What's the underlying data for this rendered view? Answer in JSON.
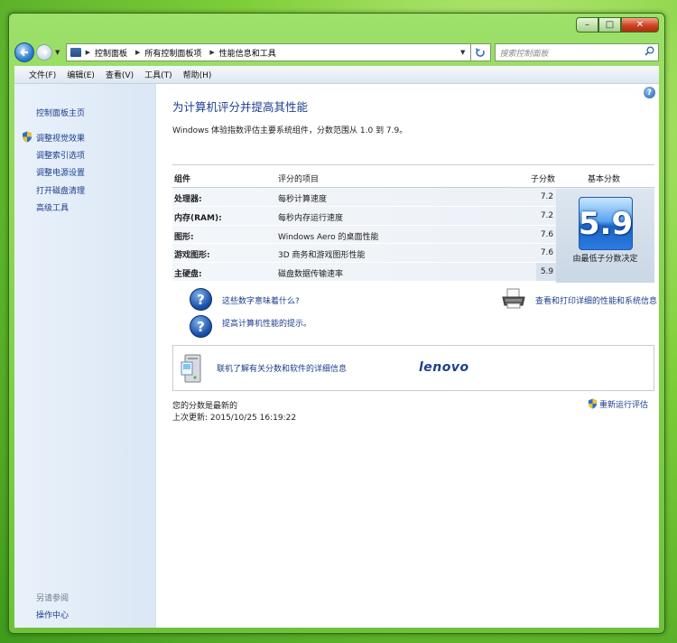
{
  "window": {
    "caption_buttons": {
      "minimize": "–",
      "maximize": "□",
      "close": "✕"
    }
  },
  "navigation": {
    "back_icon": "back-arrow-icon",
    "forward_icon": "forward-arrow-icon",
    "breadcrumb": [
      "控制面板",
      "所有控制面板项",
      "性能信息和工具"
    ],
    "search_placeholder": "搜索控制面板"
  },
  "menu": [
    "文件(F)",
    "编辑(E)",
    "查看(V)",
    "工具(T)",
    "帮助(H)"
  ],
  "sidebar": {
    "home": "控制面板主页",
    "tasks": [
      "调整视觉效果",
      "调整索引选项",
      "调整电源设置",
      "打开磁盘清理",
      "高级工具"
    ],
    "see_also_title": "另请参阅",
    "see_also": [
      "操作中心"
    ]
  },
  "main": {
    "title": "为计算机评分并提高其性能",
    "description": "Windows 体验指数评估主要系统组件，分数范围从 1.0 到 7.9。",
    "table": {
      "headers": {
        "component": "组件",
        "rated": "评分的项目",
        "subscore": "子分数",
        "basescore": "基本分数"
      },
      "rows": [
        {
          "component": "处理器:",
          "item": "每秒计算速度",
          "subscore": "7.2"
        },
        {
          "component": "内存(RAM):",
          "item": "每秒内存运行速度",
          "subscore": "7.2"
        },
        {
          "component": "图形:",
          "item": "Windows Aero 的桌面性能",
          "subscore": "7.6"
        },
        {
          "component": "游戏图形:",
          "item": "3D 商务和游戏图形性能",
          "subscore": "7.6"
        },
        {
          "component": "主硬盘:",
          "item": "磁盘数据传输速率",
          "subscore": "5.9"
        }
      ],
      "base_score": "5.9",
      "base_caption": "由最低子分数决定"
    },
    "links": {
      "what_mean": "这些数字意味着什么?",
      "tips": "提高计算机性能的提示。",
      "print": "查看和打印详细的性能和系统信息"
    },
    "panel": {
      "link": "联机了解有关分数和软件的详细信息",
      "brand": "lenovo"
    },
    "status": {
      "current": "您的分数是最新的",
      "last_updated": "上次更新: 2015/10/25 16:19:22",
      "rerun": "重新运行评估"
    }
  }
}
